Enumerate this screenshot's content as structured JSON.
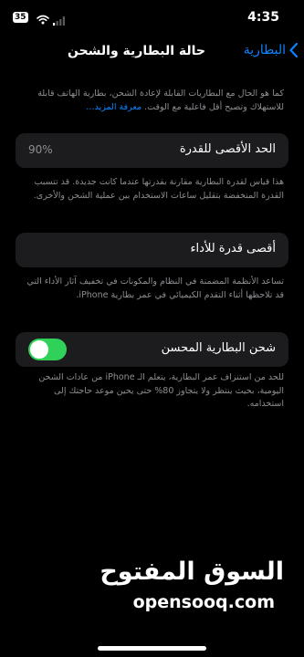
{
  "status_bar": {
    "time": "4:35",
    "battery": "35"
  },
  "nav": {
    "title": "حالة البطارية والشحن",
    "back_label": "البطارية"
  },
  "intro": {
    "text": "كما هو الحال مع البطاريات القابلة لإعادة الشحن، بطارية الهاتف قابلة للاستهلاك وتصبح أقل فاعلية مع الوقت.",
    "link": "معرفة المزيد…"
  },
  "max_capacity": {
    "label": "الحد الأقصى للقدرة",
    "value": "90%",
    "footer": "هذا قياس لقدرة البطارية مقارنة بقدرتها عندما كانت جديدة. قد تتسبب القدرة المنخفضة بتقليل ساعات الاستخدام بين عملية الشحن والأخرى."
  },
  "peak_performance": {
    "label": "أقصى قدرة للأداء",
    "footer": "تساعد الأنظمة المضمنة في النظام والمكونات في تخفيف آثار الأداء التي قد تلاحظها أثناء التقدم الكيميائي في عمر بطارية iPhone."
  },
  "optimized_charging": {
    "label": "شحن البطارية المحسن",
    "enabled": true,
    "footer": "للحد من استنزاف عمر البطارية، يتعلم الـ iPhone من عادات الشحن اليومية، بحيث ينتظر ولا يتجاوز 80% حتى يحين موعد حاجتك إلى استخدامه."
  },
  "watermark": {
    "arabic": "السوق المفتوح",
    "latin": "opensooq.com"
  },
  "colors": {
    "accent": "#0a84ff",
    "toggle_on": "#30d158",
    "cell_bg": "#1c1c1e",
    "footer_text": "#8e8e93"
  },
  "icons": [
    "wifi-icon",
    "signal-icon",
    "chevron-left-icon"
  ]
}
